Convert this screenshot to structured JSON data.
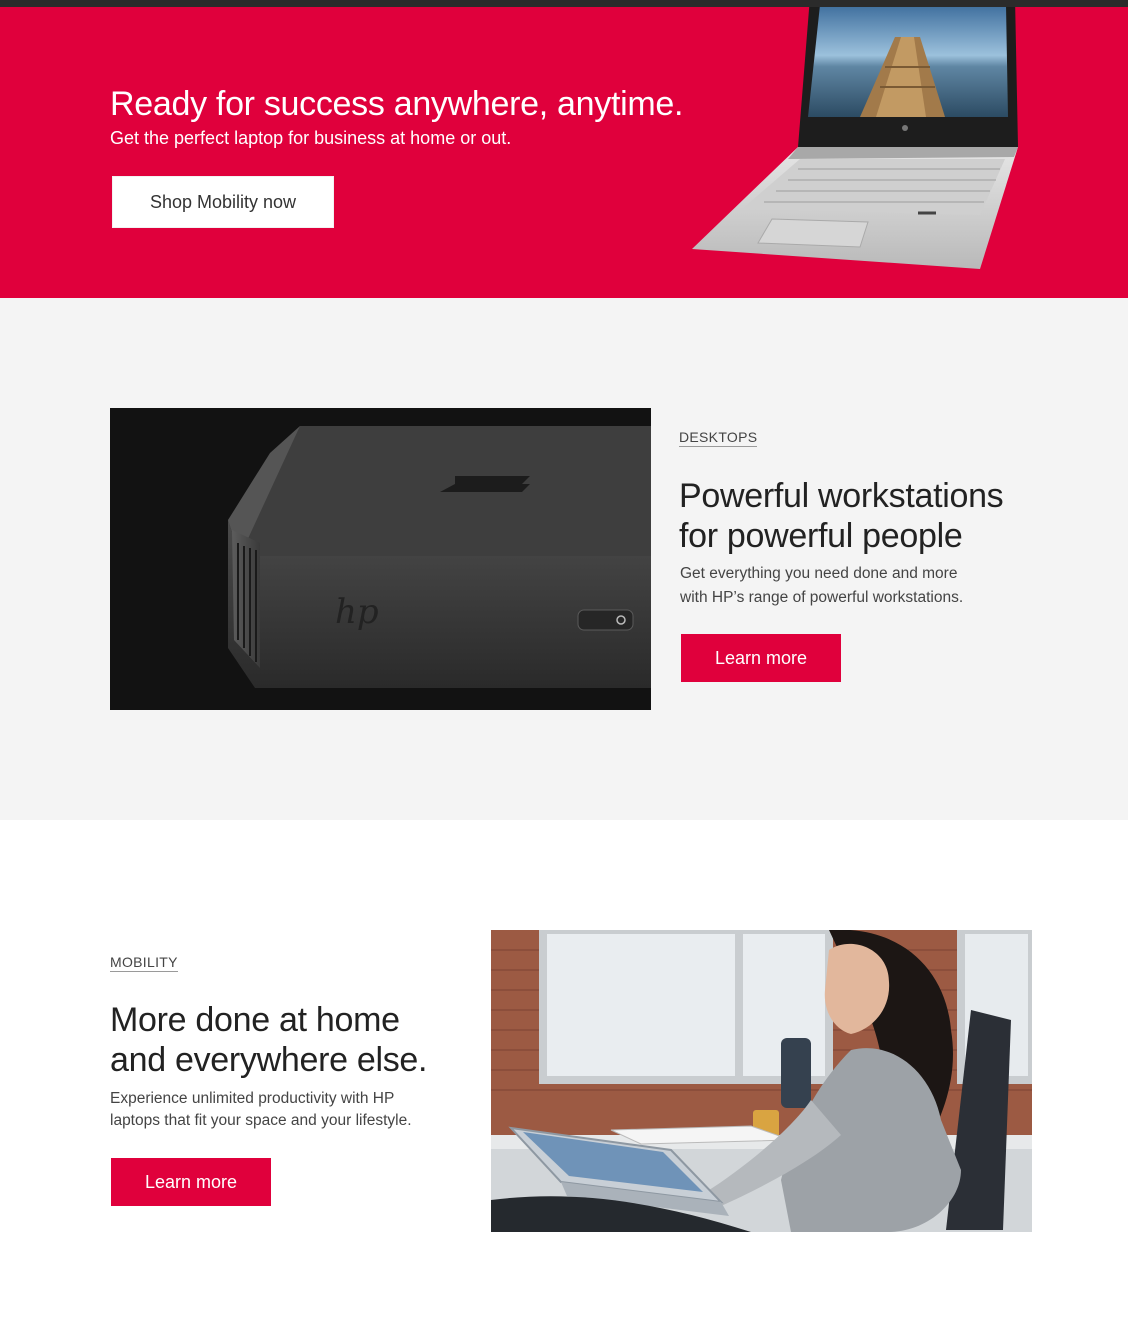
{
  "hero": {
    "title": "Ready for success anywhere, anytime.",
    "subtitle": "Get the perfect laptop for business at home or out.",
    "cta_label": "Shop Mobility now",
    "background_color": "#e0003c"
  },
  "desktops": {
    "eyebrow": "DESKTOPS",
    "title_line1": "Powerful workstations",
    "title_line2": "for powerful people",
    "body_line1": "Get everything you need done and more",
    "body_line2": "with HP’s range of powerful workstations.",
    "cta_label": "Learn more",
    "background_color": "#f4f4f4"
  },
  "mobility": {
    "eyebrow": "MOBILITY",
    "title_line1": "More done at home",
    "title_line2": "and everywhere else.",
    "body_line1": "Experience unlimited productivity with HP",
    "body_line2": "laptops that fit your space and your lifestyle.",
    "cta_label": "Learn more"
  },
  "colors": {
    "accent": "#e0003c",
    "topbar": "#2b2b2b"
  }
}
